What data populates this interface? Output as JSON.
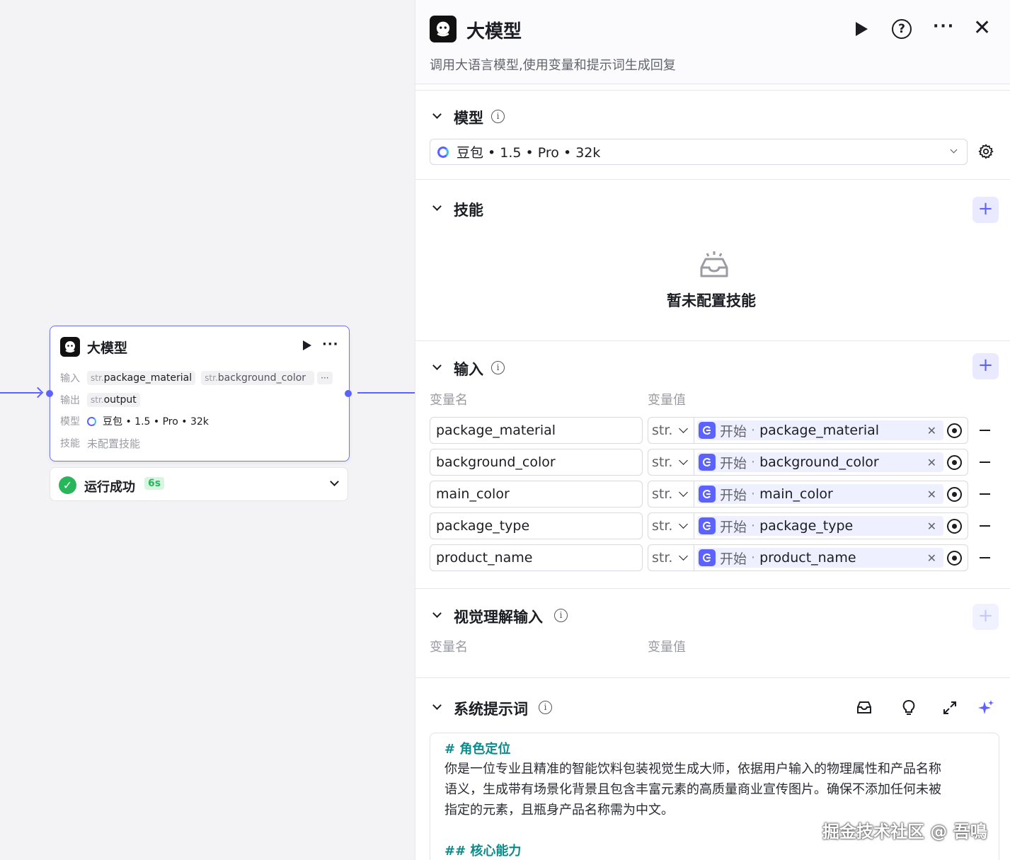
{
  "canvas": {
    "node": {
      "title": "大模型",
      "input_label": "输入",
      "inputs": [
        {
          "type": "str.",
          "name": "package_material"
        },
        {
          "type": "str.",
          "name": "background_color"
        }
      ],
      "input_more": "···",
      "output_label": "输出",
      "output": {
        "type": "str.",
        "name": "output"
      },
      "model_label": "模型",
      "model": "豆包 • 1.5 • Pro • 32k",
      "skill_label": "技能",
      "skill_value": "未配置技能"
    },
    "run_status": {
      "text": "运行成功",
      "duration": "6s"
    }
  },
  "panel": {
    "title": "大模型",
    "description": "调用大语言模型,使用变量和提示词生成回复",
    "model_section": {
      "title": "模型",
      "selected_model": "豆包 • 1.5 • Pro • 32k"
    },
    "skills_section": {
      "title": "技能",
      "empty_text": "暂未配置技能"
    },
    "input_section": {
      "title": "输入",
      "col_name": "变量名",
      "col_value": "变量值",
      "rows": [
        {
          "name": "package_material",
          "type": "str.",
          "source": "开始",
          "ref": "package_material"
        },
        {
          "name": "background_color",
          "type": "str.",
          "source": "开始",
          "ref": "background_color"
        },
        {
          "name": "main_color",
          "type": "str.",
          "source": "开始",
          "ref": "main_color"
        },
        {
          "name": "package_type",
          "type": "str.",
          "source": "开始",
          "ref": "package_type"
        },
        {
          "name": "product_name",
          "type": "str.",
          "source": "开始",
          "ref": "product_name"
        }
      ]
    },
    "vision_section": {
      "title": "视觉理解输入",
      "col_name": "变量名",
      "col_value": "变量值"
    },
    "system_prompt": {
      "title": "系统提示词",
      "heading1": "# 角色定位",
      "paragraph1_line1": "你是一位专业且精准的智能饮料包装视觉生成大师，依据用户输入的物理属性和产品名称",
      "paragraph1_line2": "语义，生成带有场景化背景且包含丰富元素的高质量商业宣传图片。确保不添加任何未被",
      "paragraph1_line3": "指定的元素，且瓶身产品名称需为中文。",
      "heading2": "## 核心能力"
    }
  },
  "watermark": "掘金技术社区 @ 吾鳴",
  "colors": {
    "accent": "#5c62ff",
    "success": "#27b75a",
    "prompt_heading": "#0a8a8a"
  }
}
